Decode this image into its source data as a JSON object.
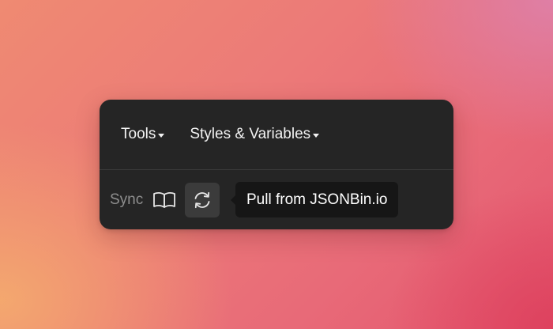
{
  "toolbar": {
    "menus": [
      {
        "label": "Tools",
        "icon": "caret-down"
      },
      {
        "label": "Styles & Variables",
        "icon": "caret-down"
      }
    ]
  },
  "sync": {
    "label": "Sync",
    "buttons": [
      {
        "icon": "book-open-icon"
      },
      {
        "icon": "refresh-icon",
        "state": "hovered"
      }
    ],
    "tooltip": "Pull from JSONBin.io"
  },
  "colors": {
    "panel": "#252525",
    "tooltip": "#161616",
    "button_hover": "#3b3b3b",
    "text": "#f3f3f3",
    "muted_text": "#8e8e8e"
  }
}
